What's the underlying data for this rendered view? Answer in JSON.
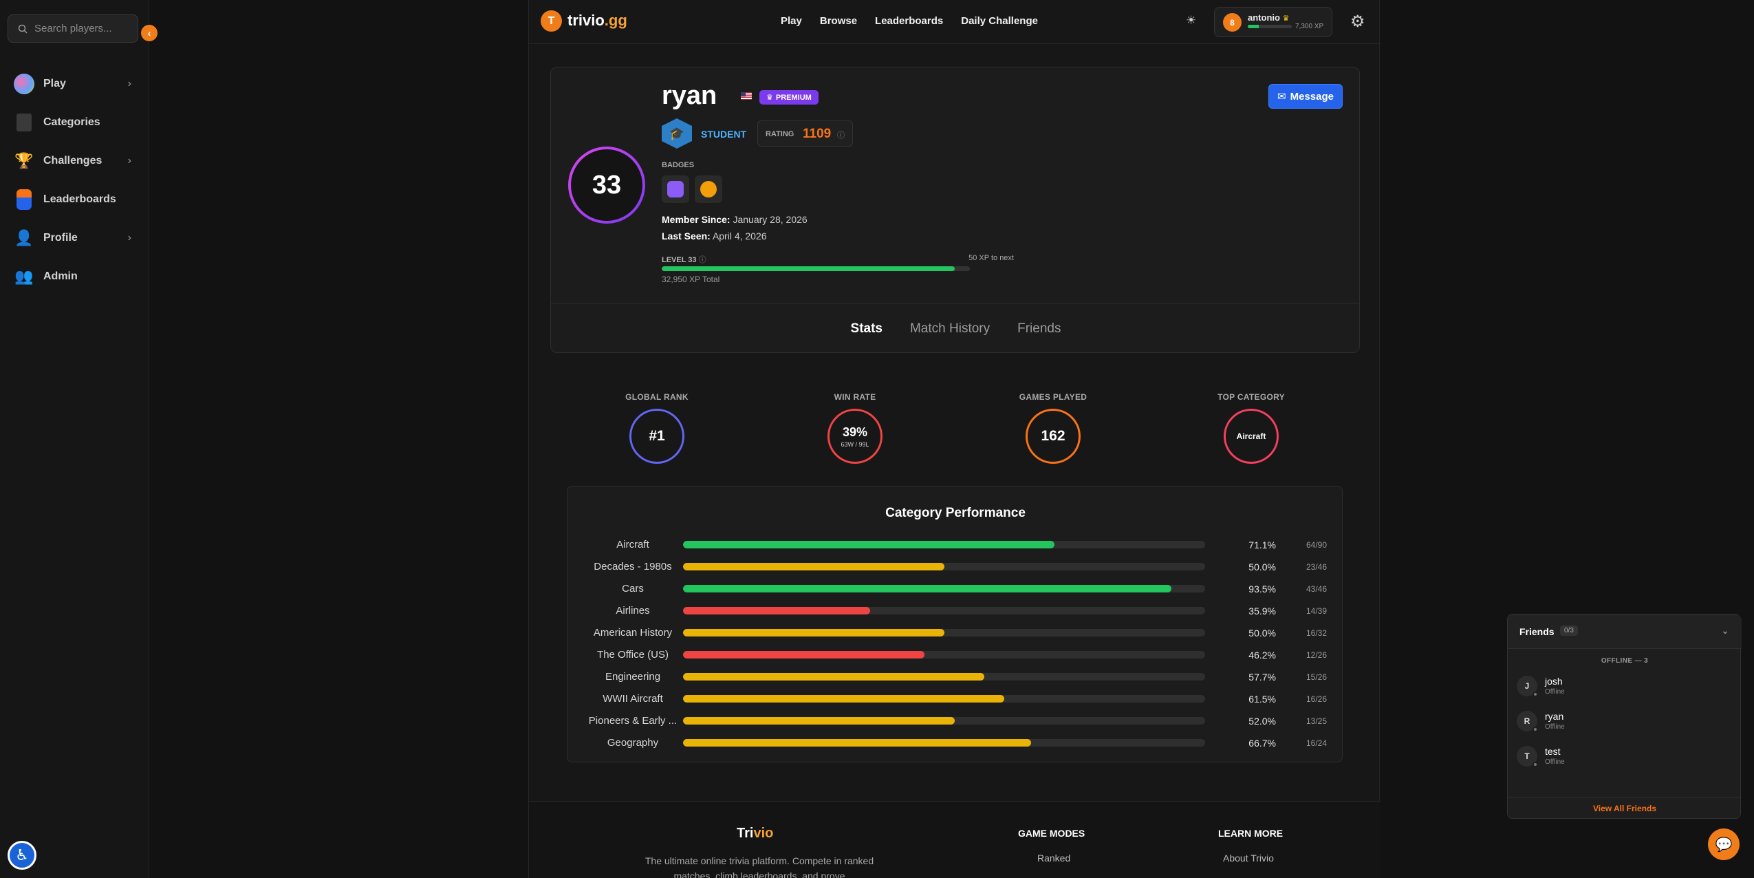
{
  "sidebar": {
    "search_placeholder": "Search players...",
    "collapse_icon": "chevron-left-icon",
    "items": [
      {
        "label": "Play",
        "icon": "brain-icon",
        "has_children": true
      },
      {
        "label": "Categories",
        "icon": "book-icon",
        "has_children": false
      },
      {
        "label": "Challenges",
        "icon": "trophy-icon",
        "has_children": true
      },
      {
        "label": "Leaderboards",
        "icon": "podium-icon",
        "has_children": false
      },
      {
        "label": "Profile",
        "icon": "user-icon",
        "has_children": true
      },
      {
        "label": "Admin",
        "icon": "admin-icon",
        "has_children": false
      }
    ]
  },
  "header": {
    "logo_letter": "T",
    "logo_main": "trivio",
    "logo_accent": ".gg",
    "nav": [
      "Play",
      "Browse",
      "Leaderboards",
      "Daily Challenge"
    ],
    "user": {
      "avatar": "8",
      "name": "antonio",
      "xp": "7,300 XP",
      "xp_fraction": 0.25
    }
  },
  "profile": {
    "level": "33",
    "username": "ryan",
    "premium_label": "PREMIUM",
    "rank_label": "STUDENT",
    "rating_label": "RATING",
    "rating_value": "1109",
    "badges_label": "BADGES",
    "member_since_label": "Member Since:",
    "member_since_value": "January 28, 2026",
    "last_seen_label": "Last Seen:",
    "last_seen_value": "April 4, 2026",
    "level_label": "LEVEL 33",
    "xp_to_next": "50 XP to next",
    "xp_fraction": 0.95,
    "xp_total": "32,950 XP Total",
    "message_label": "Message",
    "tabs": [
      "Stats",
      "Match History",
      "Friends"
    ],
    "active_tab": "Stats"
  },
  "stats": [
    {
      "title": "GLOBAL RANK",
      "value": "#1",
      "sub": "",
      "color": "#6366f1"
    },
    {
      "title": "WIN RATE",
      "value": "39%",
      "sub": "63W / 99L",
      "color": "#ef4444"
    },
    {
      "title": "GAMES PLAYED",
      "value": "162",
      "sub": "",
      "color": "#f97316"
    },
    {
      "title": "TOP CATEGORY",
      "value": "Aircraft",
      "sub": "",
      "color": "#f43f5e"
    }
  ],
  "category_performance": {
    "title": "Category Performance",
    "rows": [
      {
        "name": "Aircraft",
        "pct": "71.1%",
        "value": 71.1,
        "count": "64/90",
        "color": "#22c55e"
      },
      {
        "name": "Decades - 1980s",
        "pct": "50.0%",
        "value": 50.0,
        "count": "23/46",
        "color": "#eab308"
      },
      {
        "name": "Cars",
        "pct": "93.5%",
        "value": 93.5,
        "count": "43/46",
        "color": "#22c55e"
      },
      {
        "name": "Airlines",
        "pct": "35.9%",
        "value": 35.9,
        "count": "14/39",
        "color": "#ef4444"
      },
      {
        "name": "American History",
        "pct": "50.0%",
        "value": 50.0,
        "count": "16/32",
        "color": "#eab308"
      },
      {
        "name": "The Office (US)",
        "pct": "46.2%",
        "value": 46.2,
        "count": "12/26",
        "color": "#ef4444"
      },
      {
        "name": "Engineering",
        "pct": "57.7%",
        "value": 57.7,
        "count": "15/26",
        "color": "#eab308"
      },
      {
        "name": "WWII Aircraft",
        "pct": "61.5%",
        "value": 61.5,
        "count": "16/26",
        "color": "#eab308"
      },
      {
        "name": "Pioneers & Early ...",
        "pct": "52.0%",
        "value": 52.0,
        "count": "13/25",
        "color": "#eab308"
      },
      {
        "name": "Geography",
        "pct": "66.7%",
        "value": 66.7,
        "count": "16/24",
        "color": "#eab308"
      }
    ]
  },
  "footer": {
    "brand_main": "Tri",
    "brand_accent": "vio",
    "description": "The ultimate online trivia platform. Compete in ranked matches, climb leaderboards, and prove",
    "col1_head": "GAME MODES",
    "col1_link": "Ranked",
    "col2_head": "LEARN MORE",
    "col2_link": "About Trivio"
  },
  "friends": {
    "title": "Friends",
    "count": "0/3",
    "offline_label": "OFFLINE — 3",
    "list": [
      {
        "initial": "J",
        "name": "josh",
        "status": "Offline"
      },
      {
        "initial": "R",
        "name": "ryan",
        "status": "Offline"
      },
      {
        "initial": "T",
        "name": "test",
        "status": "Offline"
      }
    ],
    "view_all": "View All Friends"
  },
  "colors": {
    "accent": "#f07d1a",
    "primary": "#2563eb",
    "premium": "#7c3aed"
  }
}
